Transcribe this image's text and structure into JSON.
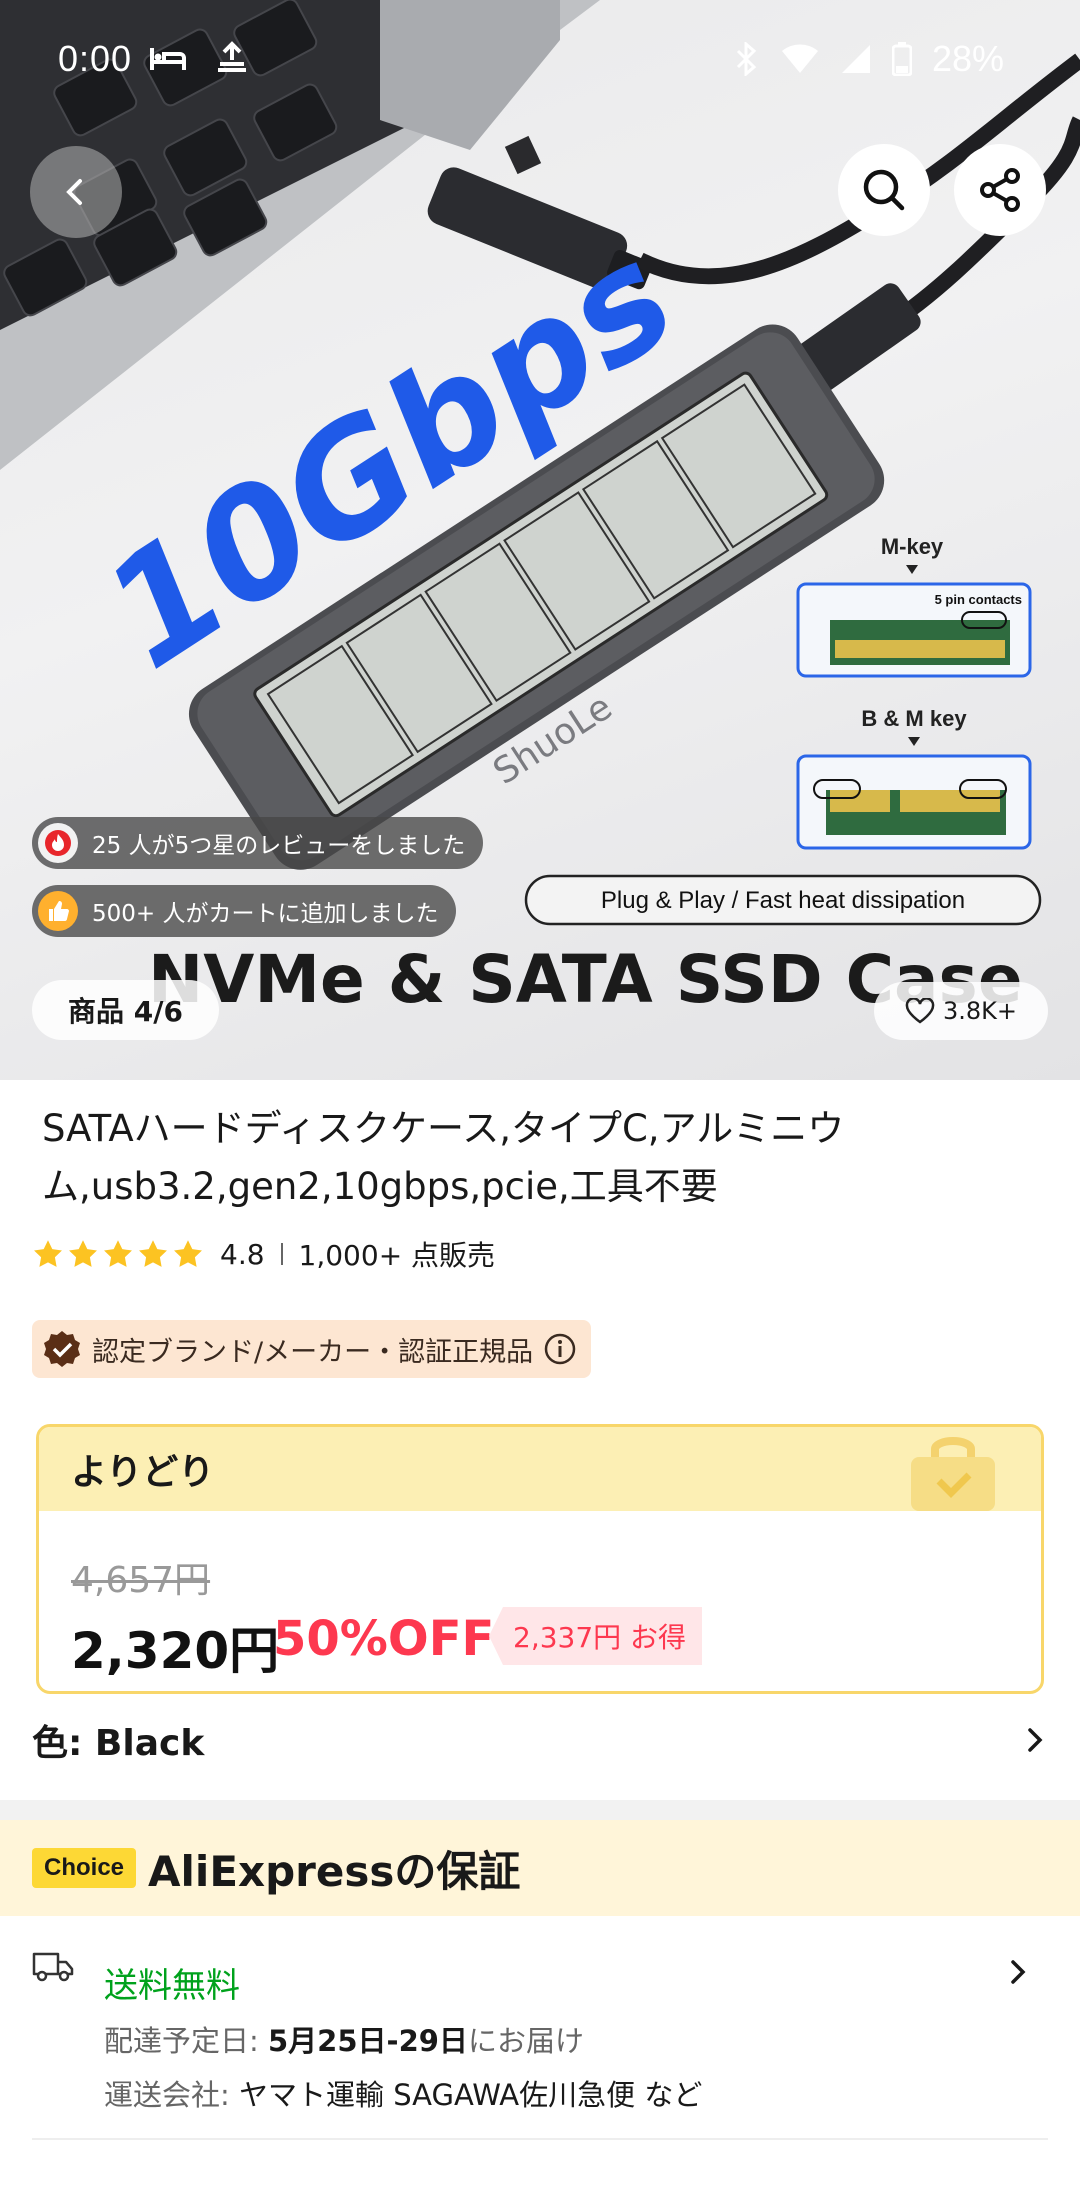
{
  "status_bar": {
    "time": "0:00",
    "battery": "28%",
    "icons": [
      "bed-icon",
      "cloud-upload-icon",
      "bluetooth-icon",
      "wifi-icon",
      "signal-icon",
      "battery-icon"
    ]
  },
  "hero": {
    "speed_text": "10Gbps",
    "brand_text": "ShuoLe",
    "mkey_label": "M-key",
    "pin_label": "5 pin contacts",
    "bmkey_label": "B & M key",
    "feature_text": "Plug & Play / Fast heat dissipation",
    "banner_text": "NVMe & SATA SSD Case",
    "review_pill": "25 人が5つ星のレビューをしました",
    "cart_pill": "500+ 人がカートに追加しました",
    "image_counter": "商品 4/6",
    "wishlist_count": "3.8K+"
  },
  "product": {
    "title": "SATAハードディスクケース,タイプC,アルミニウム,usb3.2,gen2,10gbps,pcie,工具不要",
    "rating": "4.8",
    "sold": "1,000+ 点販売",
    "stars": 5,
    "brand_badge": "認定ブランド/メーカー・認証正規品"
  },
  "price_card": {
    "heading": "よりどり",
    "old_price": "4,657円",
    "price": "2,320円",
    "discount": "50%OFF",
    "saving": "2,337円 お得"
  },
  "color": {
    "label": "色: Black"
  },
  "guarantee": {
    "choice_tag": "Choice",
    "title": "AliExpressの保証"
  },
  "shipping": {
    "title": "送料無料",
    "delivery_label": "配達予定日: ",
    "delivery_date": "5月25日-29日",
    "delivery_suffix": "にお届け",
    "carrier_label": "運送会社: ",
    "carrier_value": "ヤマト運輸 SAGAWA佐川急便 など"
  },
  "colors": {
    "accent_red": "#fd384f",
    "free_shipping_green": "#00a21c",
    "star_gold": "#fcc322",
    "choice_yellow": "#fdd835"
  }
}
